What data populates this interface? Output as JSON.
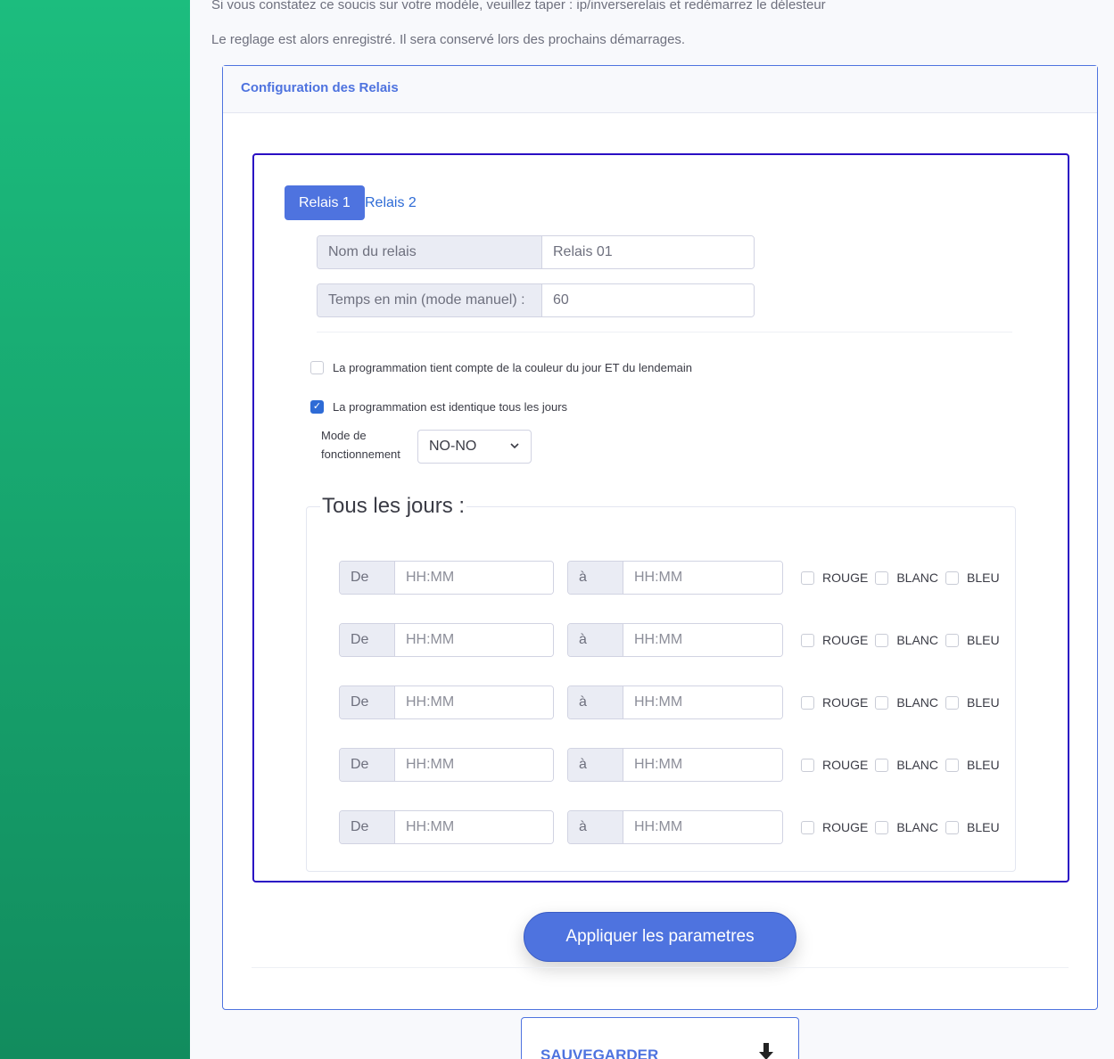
{
  "notes": {
    "line1": "Si vous constatez ce soucis sur votre modèle, veuillez taper : ip/inverserelais et redémarrez le délesteur",
    "line2": "Le reglage est alors enregistré. Il sera conservé lors des prochains démarrages."
  },
  "card": {
    "title": "Configuration des Relais"
  },
  "tabs": [
    {
      "label": "Relais 1",
      "active": true
    },
    {
      "label": "Relais 2",
      "active": false
    }
  ],
  "fields": {
    "name": {
      "label": "Nom du relais",
      "value": "Relais 01"
    },
    "time": {
      "label": "Temps en min (mode manuel) :",
      "value": "60"
    }
  },
  "options": {
    "color_tomorrow": {
      "label": "La programmation tient compte de la couleur du jour ET du lendemain",
      "checked": false
    },
    "same_every_day": {
      "label": "La programmation est identique tous les jours",
      "checked": true
    }
  },
  "mode": {
    "label_line1": "Mode de",
    "label_line2": "fonctionnement",
    "selected": "NO-NO"
  },
  "schedule": {
    "legend": "Tous les jours :",
    "from_label": "De",
    "to_label": "à",
    "placeholder": "HH:MM",
    "colors": [
      "ROUGE",
      "BLANC",
      "BLEU"
    ],
    "slots": [
      {
        "from": "",
        "to": "",
        "rouge": false,
        "blanc": false,
        "bleu": false
      },
      {
        "from": "",
        "to": "",
        "rouge": false,
        "blanc": false,
        "bleu": false
      },
      {
        "from": "",
        "to": "",
        "rouge": false,
        "blanc": false,
        "bleu": false
      },
      {
        "from": "",
        "to": "",
        "rouge": false,
        "blanc": false,
        "bleu": false
      },
      {
        "from": "",
        "to": "",
        "rouge": false,
        "blanc": false,
        "bleu": false
      }
    ]
  },
  "apply_button": "Appliquer les parametres",
  "save": {
    "label": "SAUVEGARDER",
    "icon": "download-icon"
  }
}
